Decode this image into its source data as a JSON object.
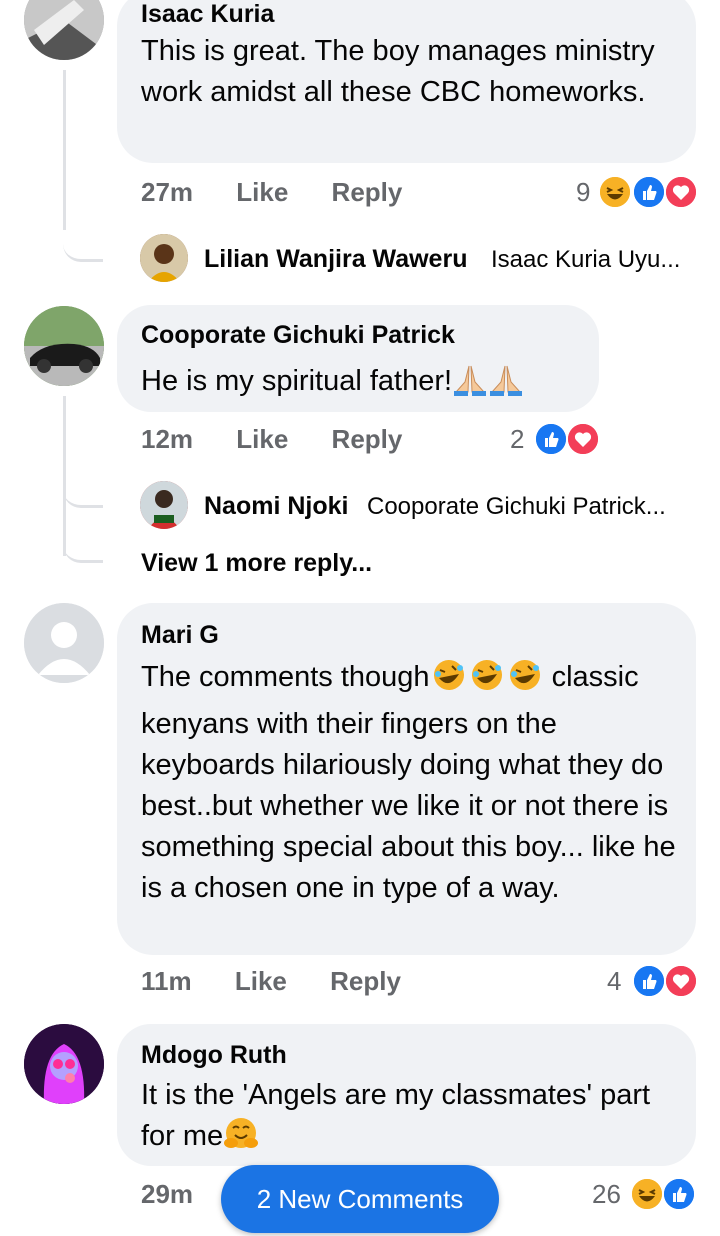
{
  "comments": [
    {
      "author": "Isaac Kuria",
      "text": "This is great. The boy manages ministry work amidst all these CBC homeworks.",
      "time": "27m",
      "like_label": "Like",
      "reply_label": "Reply",
      "reaction_count": "9",
      "reactions": [
        "haha-icon",
        "like-icon",
        "love-icon"
      ],
      "replies": [
        {
          "author": "Lilian Wanjira Waweru",
          "preview": "Isaac Kuria Uyu..."
        }
      ]
    },
    {
      "author": "Cooporate Gichuki Patrick",
      "text": "He is my spiritual father!",
      "time": "12m",
      "like_label": "Like",
      "reply_label": "Reply",
      "reaction_count": "2",
      "reactions": [
        "like-icon",
        "love-icon"
      ],
      "replies": [
        {
          "author": "Naomi Njoki",
          "preview": "Cooporate Gichuki Patrick..."
        }
      ],
      "view_more": "View 1 more reply..."
    },
    {
      "author": "Mari G",
      "text_line1": "The comments though",
      "text_rest": "classic kenyans with their fingers on the keyboards hilariously doing what they do best..but whether we like it or not there is something special about this boy... like he is a chosen one in type of a way.",
      "time": "11m",
      "like_label": "Like",
      "reply_label": "Reply",
      "reaction_count": "4",
      "reactions": [
        "like-icon",
        "love-icon"
      ]
    },
    {
      "author": "Mdogo Ruth",
      "text": "It is the 'Angels are my classmates' part for me",
      "time": "29m",
      "reaction_count": "26",
      "reactions": [
        "haha-icon",
        "like-icon"
      ]
    }
  ],
  "new_comments_button": "2 New Comments",
  "colors": {
    "like": "#1877f2",
    "love": "#f33e58",
    "haha": "#f7b125",
    "bubble": "#f0f2f5",
    "meta": "#65676b",
    "pill": "#1b74e4"
  }
}
